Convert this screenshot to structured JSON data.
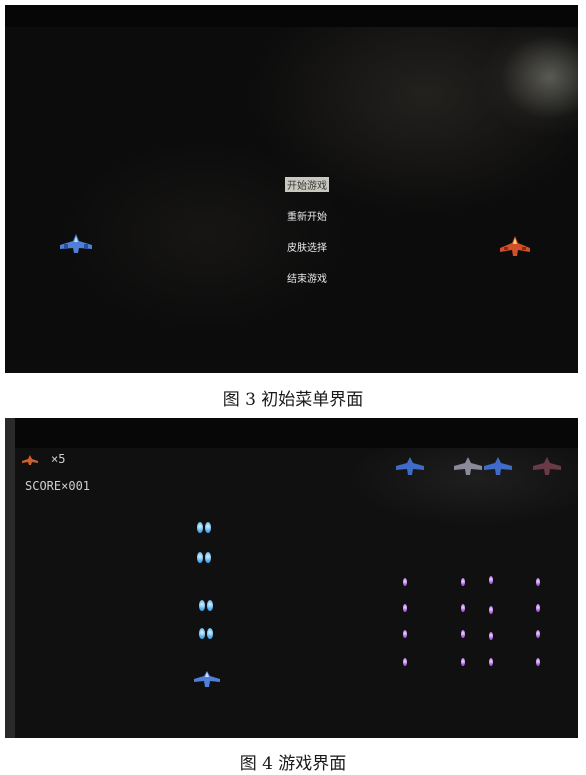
{
  "figure3": {
    "menu": {
      "items": [
        "开始游戏",
        "重新开始",
        "皮肤选择",
        "结束游戏"
      ],
      "selected_index": 0
    },
    "caption": "图 3  初始菜单界面"
  },
  "figure4": {
    "lives": "×5",
    "score": "SCORE×001",
    "caption": "图 4  游戏界面"
  },
  "colors": {
    "screen_bg": "#0c0c0c",
    "menu_text": "#e8e8e8",
    "player_bullet": "#4aa6e8",
    "enemy_bullet": "#a45ae0"
  }
}
